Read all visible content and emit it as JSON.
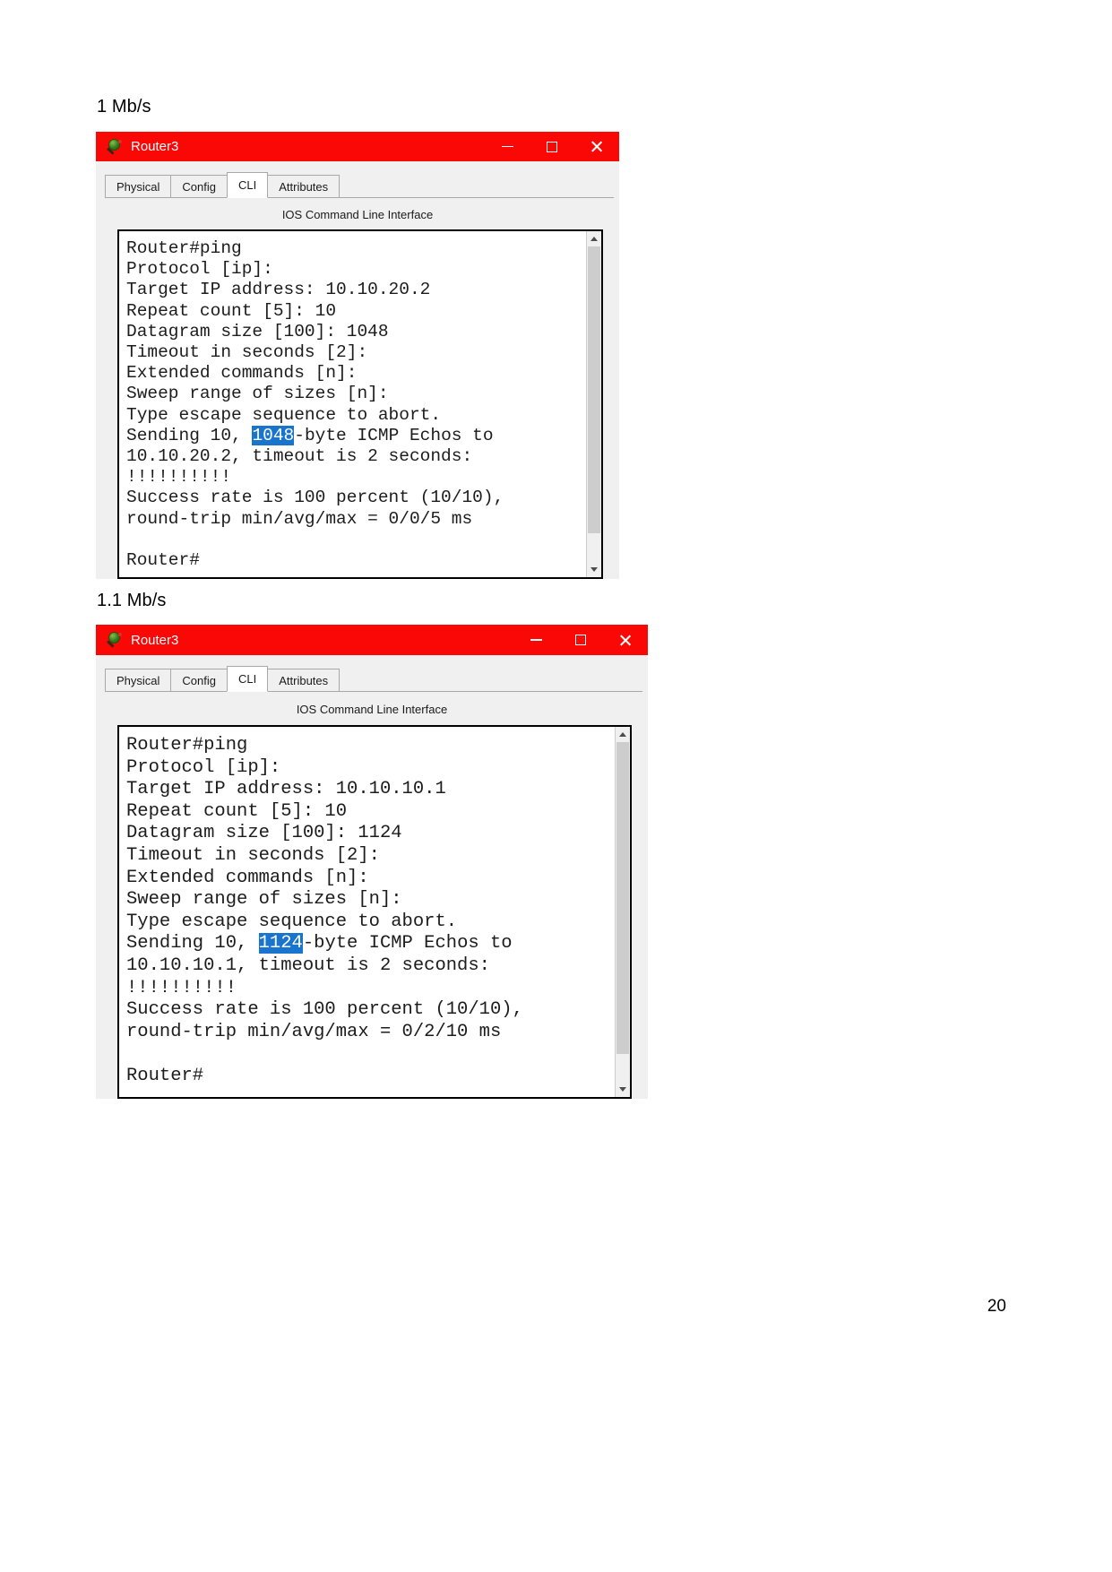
{
  "document": {
    "page_number": "20"
  },
  "sections": [
    {
      "caption": "1 Mb/s",
      "window": {
        "title": "Router3",
        "icon": "packet-tracer-router-icon",
        "controls": {
          "minimize": "minimize-icon",
          "maximize": "maximize-icon",
          "close": "close-icon"
        },
        "tabs": [
          {
            "label": "Physical",
            "active": false
          },
          {
            "label": "Config",
            "active": false
          },
          {
            "label": "CLI",
            "active": true
          },
          {
            "label": "Attributes",
            "active": false
          }
        ],
        "panel_heading": "IOS Command Line Interface",
        "terminal": {
          "before_highlight": "Router#ping\nProtocol [ip]:\nTarget IP address: 10.10.20.2\nRepeat count [5]: 10\nDatagram size [100]: 1048\nTimeout in seconds [2]:\nExtended commands [n]:\nSweep range of sizes [n]:\nType escape sequence to abort.\nSending 10, ",
          "highlight": "1048",
          "after_highlight": "-byte ICMP Echos to\n10.10.20.2, timeout is 2 seconds:\n!!!!!!!!!!\nSuccess rate is 100 percent (10/10),\nround-trip min/avg/max = 0/0/5 ms\n\nRouter#",
          "highlight_color": "#1874cd"
        }
      }
    },
    {
      "caption": "1.1 Mb/s",
      "window": {
        "title": "Router3",
        "icon": "packet-tracer-router-icon",
        "controls": {
          "minimize": "minimize-icon",
          "maximize": "maximize-icon",
          "close": "close-icon"
        },
        "tabs": [
          {
            "label": "Physical",
            "active": false
          },
          {
            "label": "Config",
            "active": false
          },
          {
            "label": "CLI",
            "active": true
          },
          {
            "label": "Attributes",
            "active": false
          }
        ],
        "panel_heading": "IOS Command Line Interface",
        "terminal": {
          "before_highlight": "Router#ping\nProtocol [ip]:\nTarget IP address: 10.10.10.1\nRepeat count [5]: 10\nDatagram size [100]: 1124\nTimeout in seconds [2]:\nExtended commands [n]:\nSweep range of sizes [n]:\nType escape sequence to abort.\nSending 10, ",
          "highlight": "1124",
          "after_highlight": "-byte ICMP Echos to\n10.10.10.1, timeout is 2 seconds:\n!!!!!!!!!!\nSuccess rate is 100 percent (10/10),\nround-trip min/avg/max = 0/2/10 ms\n\nRouter#",
          "highlight_color": "#1874cd"
        }
      }
    }
  ],
  "theme": {
    "titlebar_color": "#fa0806",
    "panel_color": "#f0f0f0",
    "terminal_bg": "#ffffff",
    "terminal_fg": "#1c1c1c"
  }
}
